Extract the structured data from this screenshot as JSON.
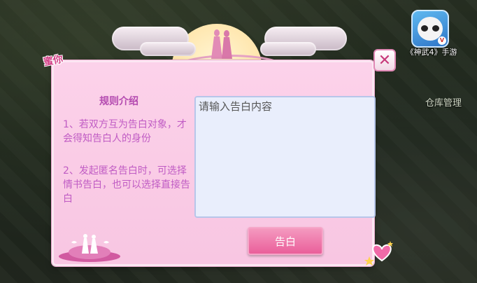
{
  "top_right": {
    "app_caption": "《神武4》手游",
    "warehouse_label": "仓库管理"
  },
  "panel": {
    "title": "蜜你",
    "close_symbol": "✕",
    "rules": {
      "heading": "规则介绍",
      "items": [
        "1、若双方互为告白对象，才会得知告白人的身份",
        "2、发起匿名告白时，可选择情书告白，也可以选择直接告白"
      ]
    },
    "message_input": {
      "placeholder": "请输入告白内容",
      "value": ""
    },
    "confess_button": "告白"
  },
  "icons": {
    "close": "close-icon",
    "moon": "moon-decoration",
    "hearts": "heart-decoration"
  },
  "colors": {
    "panel_bg": "#fcd2ea",
    "accent": "#ea5f9a",
    "rule_text": "#c05cc4",
    "input_bg": "#e9eefc"
  }
}
